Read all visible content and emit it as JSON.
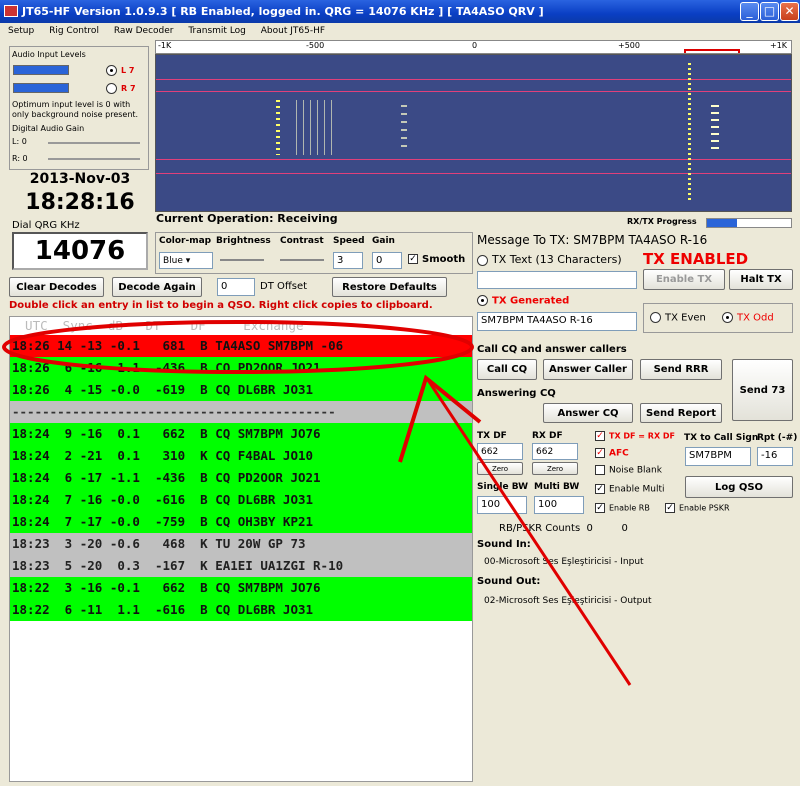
{
  "window": {
    "title": "JT65-HF Version 1.0.9.3  [ RB Enabled, logged in.  QRG = 14076 KHz ] [ TA4ASO QRV ]",
    "buttons": [
      "_",
      "□",
      "✕"
    ]
  },
  "menu": [
    "Setup",
    "Rig Control",
    "Raw Decoder",
    "Transmit Log",
    "About JT65-HF"
  ],
  "audio": {
    "title": "Audio Input Levels",
    "left": "L 7",
    "right": "R 7",
    "hint": "Optimum input level is 0 with only background noise present.",
    "gain_title": "Digital Audio Gain",
    "gain_l": "L: 0",
    "gain_r": "R: 0"
  },
  "clock": {
    "date": "2013-Nov-03",
    "time": "18:28:16",
    "qrg_label": "Dial QRG KHz",
    "qrg": "14076"
  },
  "scale": [
    "-1K",
    "-500",
    "0",
    "+500",
    "+1K"
  ],
  "ops": {
    "label": "Current Operation:  Receiving",
    "colormap_label": "Color-map",
    "colormap": "Blue",
    "brightness": "Brightness",
    "contrast": "Contrast",
    "speed": "Speed",
    "speed_val": "3",
    "gain": "Gain",
    "gain_val": "0",
    "smooth": "Smooth"
  },
  "progress_label": "RX/TX Progress",
  "buttons": {
    "clear": "Clear Decodes",
    "decode": "Decode Again",
    "dt_val": "0",
    "dt_label": "DT Offset",
    "restore": "Restore Defaults"
  },
  "hint": "Double click an entry in list to begin a QSO.  Right click copies to clipboard.",
  "list": {
    "header": "  UTC  Sync  dB   DT    DF     Exchange",
    "rows": [
      {
        "t": "18:26 14 -13 -0.1   681  B TA4ASO SM7BPM -06",
        "c": "red"
      },
      {
        "t": "18:26  6 -16 -1.1  -436  B CQ PD2OOR JO21",
        "c": "green"
      },
      {
        "t": "18:26  4 -15 -0.0  -619  B CQ DL6BR JO31",
        "c": "green"
      },
      {
        "t": "-------------------------------------------",
        "c": "sep"
      },
      {
        "t": "18:24  9 -16  0.1   662  B CQ SM7BPM JO76",
        "c": "green"
      },
      {
        "t": "18:24  2 -21  0.1   310  K CQ F4BAL JO10",
        "c": "green"
      },
      {
        "t": "18:24  6 -17 -1.1  -436  B CQ PD2OOR JO21",
        "c": "green"
      },
      {
        "t": "18:24  7 -16 -0.0  -616  B CQ DL6BR JO31",
        "c": "green"
      },
      {
        "t": "18:24  7 -17 -0.0  -759  B CQ OH3BY KP21",
        "c": "green"
      },
      {
        "t": "18:23  3 -20 -0.6   468  K TU 20W GP 73",
        "c": "gray"
      },
      {
        "t": "18:23  5 -20  0.3  -167  K EA1EI UA1ZGI R-10",
        "c": "gray"
      },
      {
        "t": "18:22  3 -16 -0.1   662  B CQ SM7BPM JO76",
        "c": "green"
      },
      {
        "t": "18:22  6 -11  1.1  -616  B CQ DL6BR JO31",
        "c": "green"
      }
    ]
  },
  "tx": {
    "message_label": "Message To TX: SM7BPM TA4ASO R-16",
    "tx_text_label": "TX Text (13 Characters)",
    "enabled": "TX ENABLED",
    "enable_btn": "Enable TX",
    "halt_btn": "Halt TX",
    "generated_label": "TX Generated",
    "generated_val": "SM7BPM TA4ASO R-16",
    "even": "TX Even",
    "odd": "TX Odd",
    "cq_section": "Call CQ and answer callers",
    "call_cq": "Call CQ",
    "answer_caller": "Answer Caller",
    "send_rrr": "Send RRR",
    "send73": "Send 73",
    "answering": "Answering CQ",
    "answer_cq": "Answer CQ",
    "send_report": "Send Report",
    "txdf_label": "TX DF",
    "txdf": "662",
    "rxdf_label": "RX DF",
    "rxdf": "662",
    "zero": "Zero",
    "txeqrx": "TX DF = RX DF",
    "afc": "AFC",
    "noise": "Noise Blank",
    "multi": "Enable Multi",
    "rb": "Enable RB",
    "pskr": "Enable PSKR",
    "call_label": "TX to Call Sign",
    "call": "SM7BPM",
    "rpt_label": "Rpt (-#)",
    "rpt": "-16",
    "log": "Log QSO",
    "sbw_label": "Single BW",
    "sbw": "100",
    "mbw_label": "Multi BW",
    "mbw": "100",
    "counts": "RB/PSKR Counts  0         0",
    "sound_in_label": "Sound In:",
    "sound_in": "00-Microsoft Ses Eşleştiricisi - Input",
    "sound_out_label": "Sound Out:",
    "sound_out": "02-Microsoft Ses Eşleştiricisi - Output"
  }
}
